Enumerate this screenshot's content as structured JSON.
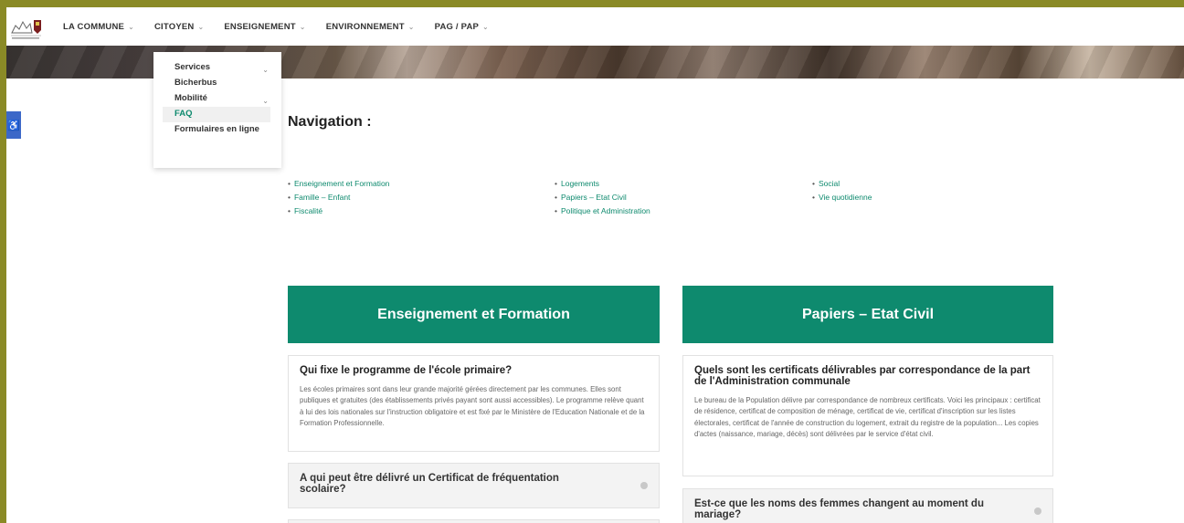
{
  "header": {
    "logo_alt": "Commune logo",
    "nav": [
      {
        "label": "LA COMMUNE",
        "chevron": "⌄"
      },
      {
        "label": "CITOYEN",
        "chevron": "⌄"
      },
      {
        "label": "ENSEIGNEMENT",
        "chevron": "⌄"
      },
      {
        "label": "ENVIRONNEMENT",
        "chevron": "⌄"
      },
      {
        "label": "PAG / PAP",
        "chevron": "⌄"
      }
    ]
  },
  "dropdown": {
    "items": [
      {
        "label": "Services",
        "has_submenu": true
      },
      {
        "label": "Bicherbus",
        "has_submenu": false
      },
      {
        "label": "Mobilité",
        "has_submenu": true
      },
      {
        "label": "FAQ",
        "has_submenu": false,
        "active": true
      },
      {
        "label": "Formulaires en ligne",
        "has_submenu": false
      }
    ],
    "chevron": "⌄"
  },
  "accessibility": {
    "icon": "wheelchair-icon",
    "glyph": "♿"
  },
  "navigation": {
    "title": "Navigation :",
    "columns": [
      [
        "Enseignement et Formation",
        "Famille – Enfant",
        "Fiscalité"
      ],
      [
        "Logements",
        "Papiers – Etat Civil",
        "Politique et Administration"
      ],
      [
        "Social",
        "Vie quotidienne"
      ]
    ]
  },
  "sections": [
    {
      "title": "Enseignement et Formation",
      "open_question": {
        "question": "Qui fixe le programme de l'école primaire?",
        "answer": "Les écoles primaires sont dans leur grande majorité gérées directement par les communes. Elles sont publiques et gratuites (des établissements privés payant sont aussi accessibles). Le programme relève quant à lui des lois nationales sur l'instruction obligatoire et est fixé par le Ministère de l'Education Nationale et de la Formation Professionnelle."
      },
      "closed_question": "A qui peut être délivré un Certificat de fréquentation scolaire?"
    },
    {
      "title": "Papiers – Etat Civil",
      "open_question": {
        "question": "Quels sont les certificats délivrables par correspondance de la part de l'Administration communale",
        "answer": "Le bureau de la Population délivre par correspondance de nombreux certificats. Voici les principaux : certificat de résidence, certificat de composition de ménage, certificat de vie, certificat d'inscription sur les listes électorales, certificat de l'année de construction du logement, extrait du registre de la population... Les copies d'actes (naissance, mariage, décès) sont délivrées par le service d'état civil."
      },
      "closed_question": "Est-ce que les noms des femmes changent au moment du mariage?"
    }
  ],
  "colors": {
    "accent": "#0e8a6e",
    "frame": "#8a8a26",
    "a11y": "#3c68c8"
  }
}
